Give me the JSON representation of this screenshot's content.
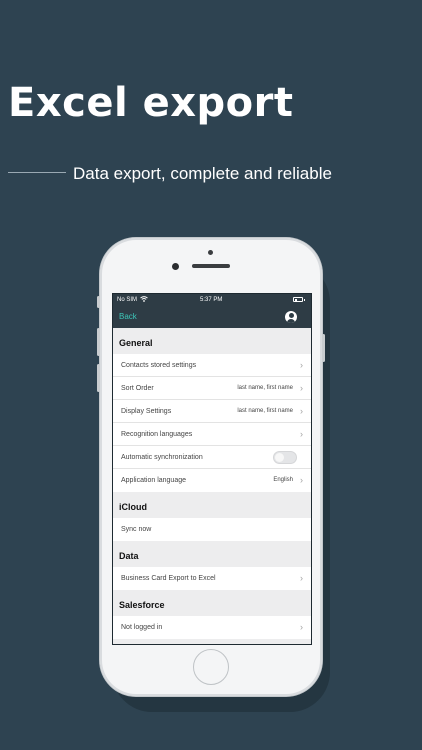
{
  "promo": {
    "headline": "Excel export",
    "subtitle": "Data export, complete and reliable"
  },
  "status_bar": {
    "carrier": "No SIM",
    "wifi_icon": "wifi-icon",
    "time": "5:37 PM",
    "battery_icon": "battery-icon"
  },
  "nav": {
    "back_label": "Back",
    "profile_icon": "profile-icon"
  },
  "sections": {
    "general": {
      "header": "General",
      "contacts_stored": {
        "label": "Contacts stored settings"
      },
      "sort_order": {
        "label": "Sort Order",
        "value": "last name,  first name"
      },
      "display_settings": {
        "label": "Display Settings",
        "value": "last name,  first name"
      },
      "recognition_languages": {
        "label": "Recognition languages"
      },
      "auto_sync": {
        "label": "Automatic synchronization",
        "enabled": false
      },
      "app_language": {
        "label": "Application language",
        "value": "English"
      }
    },
    "icloud": {
      "header": "iCloud",
      "sync_now": {
        "label": "Sync now"
      }
    },
    "data": {
      "header": "Data",
      "excel_export": {
        "label": "Business Card Export to Excel"
      }
    },
    "salesforce": {
      "header": "Salesforce",
      "login_status": {
        "label": "Not logged in"
      }
    }
  },
  "colors": {
    "background": "#2e4351",
    "navbar": "#2e3c45",
    "accent": "#3dc6b8"
  }
}
